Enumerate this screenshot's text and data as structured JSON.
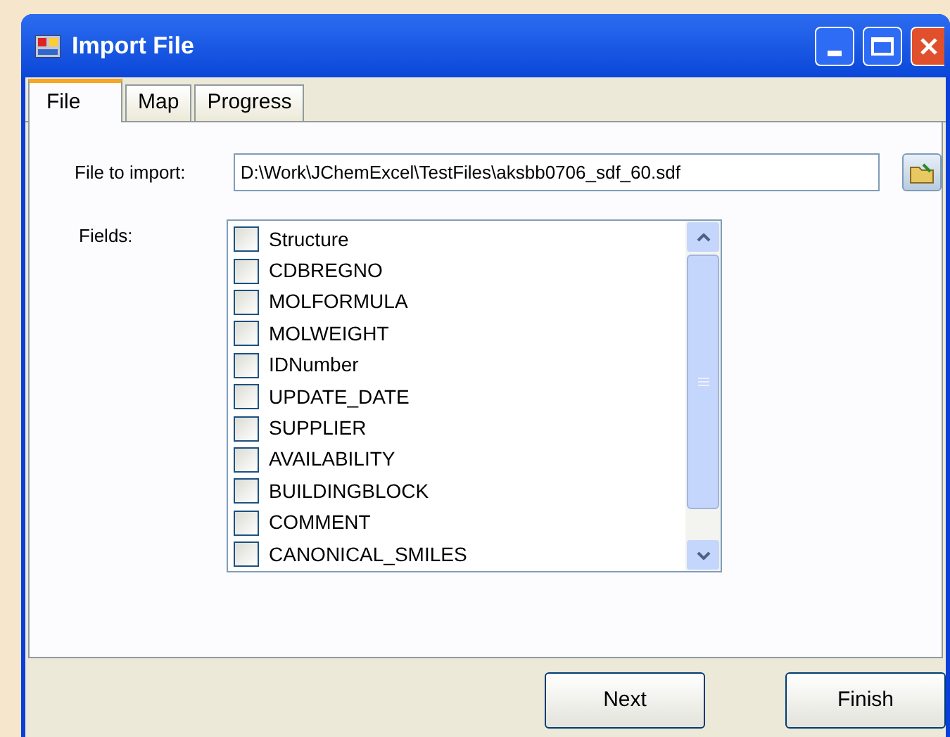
{
  "window": {
    "title": "Import File"
  },
  "tabs": [
    {
      "label": "File",
      "selected": true
    },
    {
      "label": "Map",
      "selected": false
    },
    {
      "label": "Progress",
      "selected": false
    }
  ],
  "file_to_import": {
    "label": "File to import:",
    "value": "D:\\Work\\JChemExcel\\TestFiles\\aksbb0706_sdf_60.sdf"
  },
  "fields": {
    "label": "Fields:",
    "items": [
      {
        "label": "Structure",
        "checked": false
      },
      {
        "label": "CDBREGNO",
        "checked": false
      },
      {
        "label": "MOLFORMULA",
        "checked": false
      },
      {
        "label": "MOLWEIGHT",
        "checked": false
      },
      {
        "label": "IDNumber",
        "checked": false
      },
      {
        "label": "UPDATE_DATE",
        "checked": false
      },
      {
        "label": "SUPPLIER",
        "checked": false
      },
      {
        "label": "AVAILABILITY",
        "checked": false
      },
      {
        "label": "BUILDINGBLOCK",
        "checked": false
      },
      {
        "label": "COMMENT",
        "checked": false
      },
      {
        "label": "CANONICAL_SMILES",
        "checked": false
      }
    ]
  },
  "buttons": [
    "Next",
    "Finish"
  ]
}
